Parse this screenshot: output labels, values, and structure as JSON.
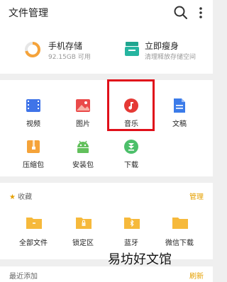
{
  "header": {
    "title": "文件管理"
  },
  "storage": {
    "phone": {
      "name": "手机存储",
      "detail": "92.15GB 可用"
    },
    "cleanup": {
      "name": "立即瘦身",
      "detail": "清理释放存储空间"
    }
  },
  "categories": [
    {
      "label": "视频",
      "icon": "video-icon",
      "color": "#3f74e8"
    },
    {
      "label": "图片",
      "icon": "image-icon",
      "color": "#ea4a4a"
    },
    {
      "label": "音乐",
      "icon": "music-icon",
      "color": "#e53935"
    },
    {
      "label": "文稿",
      "icon": "document-icon",
      "color": "#3b7be9"
    },
    {
      "label": "压缩包",
      "icon": "archive-icon",
      "color": "#f5a33a"
    },
    {
      "label": "安装包",
      "icon": "android-icon",
      "color": "#62c05c"
    },
    {
      "label": "下载",
      "icon": "download-icon",
      "color": "#4cbf6a"
    }
  ],
  "favorites": {
    "title": "收藏",
    "manage": "管理",
    "folders": [
      {
        "label": "全部文件",
        "icon": "folder-icon"
      },
      {
        "label": "锁定区",
        "icon": "lock-folder-icon"
      },
      {
        "label": "蓝牙",
        "icon": "bluetooth-folder-icon"
      },
      {
        "label": "微信下载",
        "icon": "folder-icon"
      }
    ]
  },
  "recent": {
    "title": "最近添加",
    "refresh": "刷新"
  },
  "watermark": "易坊好文馆",
  "colors": {
    "accent": "#e5a000",
    "folder": "#f6b93b",
    "highlight": "#e0101a"
  }
}
